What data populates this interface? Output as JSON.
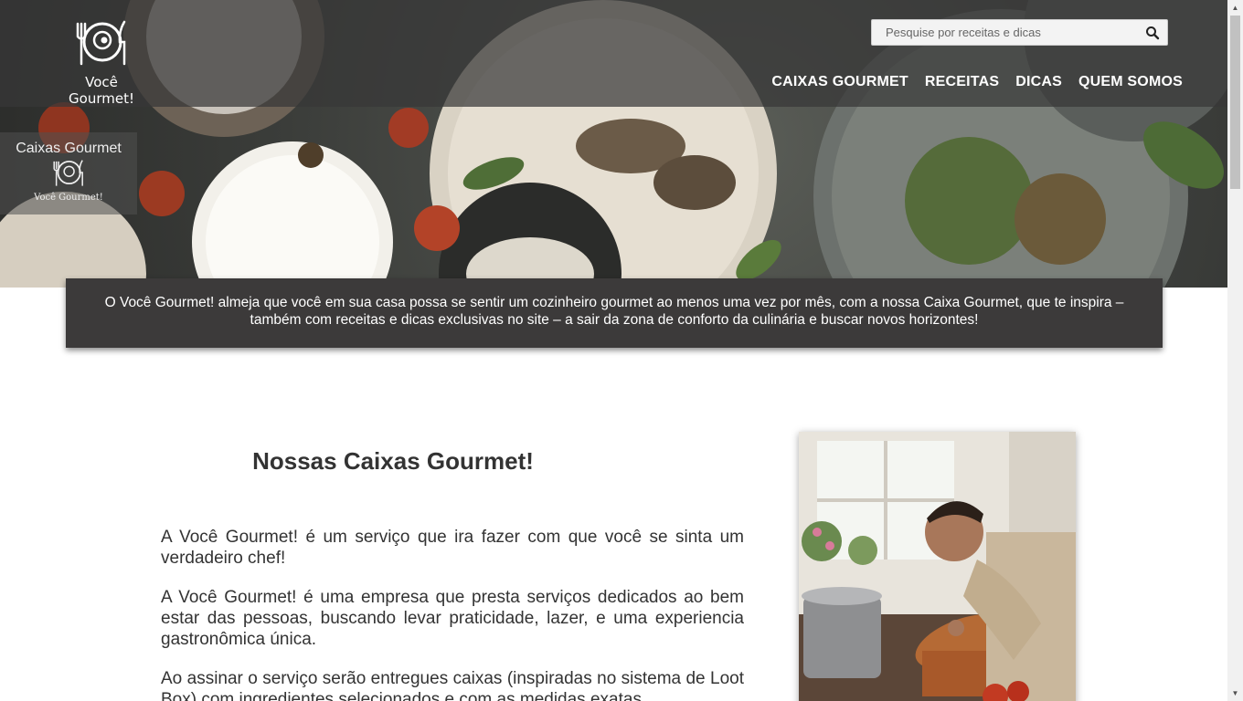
{
  "logo": {
    "text": "Você Gourmet!",
    "icon": "plate-fork-knife-icon"
  },
  "search": {
    "placeholder": "Pesquise por receitas e dicas",
    "icon": "search-icon"
  },
  "nav": {
    "items": [
      {
        "label": "CAIXAS GOURMET"
      },
      {
        "label": "RECEITAS"
      },
      {
        "label": "DICAS"
      },
      {
        "label": "QUEM SOMOS"
      }
    ]
  },
  "side_badge": {
    "title": "Caixas Gourmet",
    "subtitle": "Você Gourmet!"
  },
  "intro": {
    "text": "O Você Gourmet! almeja que você em sua casa possa se sentir um cozinheiro gourmet ao menos uma vez por mês, com a nossa Caixa Gourmet, que te inspira – também com receitas e dicas exclusivas no site – a sair da zona de conforto da culinária e buscar novos horizontes!"
  },
  "main": {
    "title": "Nossas Caixas Gourmet!",
    "paragraphs": [
      "A Você Gourmet! é um serviço que ira fazer com que você se sinta um verdadeiro chef!",
      "A Você Gourmet! é uma empresa que presta serviços dedicados ao bem estar das pessoas, buscando levar praticidade, lazer, e uma experiencia gastronômica única.",
      "Ao assinar o serviço serão entregues caixas (inspiradas no sistema de Loot Box) com ingredientes selecionados e com as medidas exatas"
    ]
  },
  "colors": {
    "header_overlay": "#373737",
    "intro_bg": "#3c3a3a",
    "text": "#333333"
  }
}
